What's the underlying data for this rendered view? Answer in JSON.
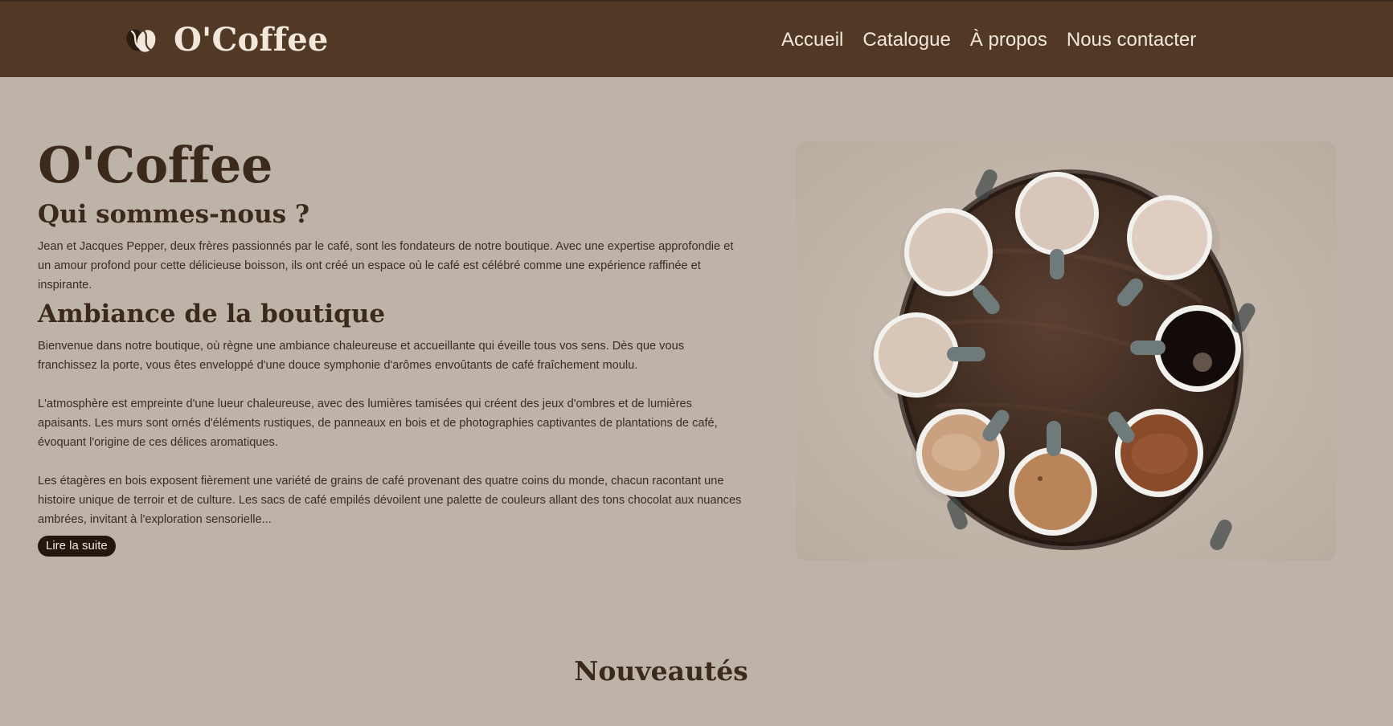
{
  "header": {
    "brand_name": "O'Coffee",
    "nav": [
      "Accueil",
      "Catalogue",
      "À propos",
      "Nous contacter"
    ]
  },
  "main": {
    "title": "O'Coffee",
    "about_title": "Qui sommes-nous ?",
    "about_text": "Jean et Jacques Pepper, deux frères passionnés par le café, sont les fondateurs de notre boutique. Avec une expertise approfondie et un amour profond pour cette délicieuse boisson, ils ont créé un espace où le café est célébré comme une expérience raffinée et inspirante.",
    "ambiance_title": "Ambiance de la boutique",
    "ambiance_paragraphs": [
      "Bienvenue dans notre boutique, où règne une ambiance chaleureuse et accueillante qui éveille tous vos sens. Dès que vous franchissez la porte, vous êtes enveloppé d'une douce symphonie d'arômes envoûtants de café fraîchement moulu.",
      "L'atmosphère est empreinte d'une lueur chaleureuse, avec des lumières tamisées qui créent des jeux d'ombres et de lumières apaisants. Les murs sont ornés d'éléments rustiques, de panneaux en bois et de photographies captivantes de plantations de café, évoquant l'origine de ces délices aromatiques.",
      "Les étagères en bois exposent fièrement une variété de grains de café provenant des quatre coins du monde, chacun racontant une histoire unique de terroir et de culture. Les sacs de café empilés dévoilent une palette de couleurs allant des tons chocolat aux nuances ambrées, invitant à l'exploration sensorielle..."
    ],
    "read_more_label": "Lire la suite"
  },
  "sections": {
    "new_title": "Nouveautés"
  },
  "icons": {
    "brand": "coffee-bean-icon"
  },
  "colors": {
    "header_bg": "#523925",
    "page_bg": "#beb3a9",
    "text_dark": "#3b291c",
    "button_bg": "#24170f",
    "header_text": "#f2e7db"
  }
}
